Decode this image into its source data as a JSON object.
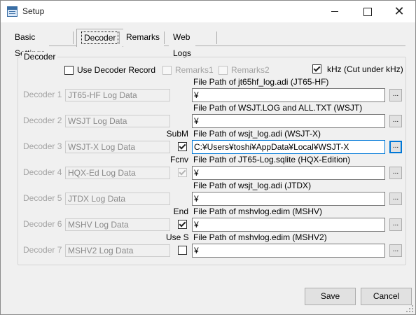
{
  "window": {
    "title": "Setup"
  },
  "tabs": [
    "Basic Settings",
    "Decoder",
    "Remarks",
    "Web Logs"
  ],
  "group": {
    "title": "Decoder"
  },
  "top_options": {
    "use_decoder_record": "Use Decoder Record",
    "remarks1": "Remarks1",
    "remarks2": "Remarks2",
    "khz": "kHz (Cut under kHz)"
  },
  "decoders": [
    {
      "label": "Decoder 1",
      "name": "JT65-HF Log Data",
      "side": "",
      "has_checkbox": false,
      "checked": false,
      "caption": "File Path of jt65hf_log.adi (JT65-HF)",
      "path": "¥"
    },
    {
      "label": "Decoder 2",
      "name": "WSJT Log Data",
      "side": "",
      "has_checkbox": false,
      "checked": false,
      "caption": "File Path of WSJT.LOG and ALL.TXT (WSJT)",
      "path": "¥"
    },
    {
      "label": "Decoder 3",
      "name": "WSJT-X Log Data",
      "side": "SubM",
      "has_checkbox": true,
      "checked": true,
      "caption": "File Path of wsjt_log.adi (WSJT-X)",
      "path": "C:¥Users¥toshi¥AppData¥Local¥WSJT-X"
    },
    {
      "label": "Decoder 4",
      "name": "HQX-Ed Log Data",
      "side": "Fcnv",
      "has_checkbox": true,
      "checked": true,
      "caption": "File Path of JT65-Log.sqlite (HQX-Edition)",
      "path": "¥"
    },
    {
      "label": "Decoder 5",
      "name": "JTDX Log Data",
      "side": "",
      "has_checkbox": false,
      "checked": false,
      "caption": "File Path of wsjt_log.adi (JTDX)",
      "path": "¥"
    },
    {
      "label": "Decoder 6",
      "name": "MSHV Log Data",
      "side": "End",
      "has_checkbox": true,
      "checked": true,
      "caption": "File Path of mshvlog.edim (MSHV)",
      "path": "¥"
    },
    {
      "label": "Decoder 7",
      "name": "MSHV2 Log Data",
      "side": "Use S",
      "has_checkbox": true,
      "checked": false,
      "caption": "File Path of mshvlog.edim (MSHV2)",
      "path": "¥"
    }
  ],
  "browse_label": "...",
  "buttons": {
    "save": "Save",
    "cancel": "Cancel"
  }
}
